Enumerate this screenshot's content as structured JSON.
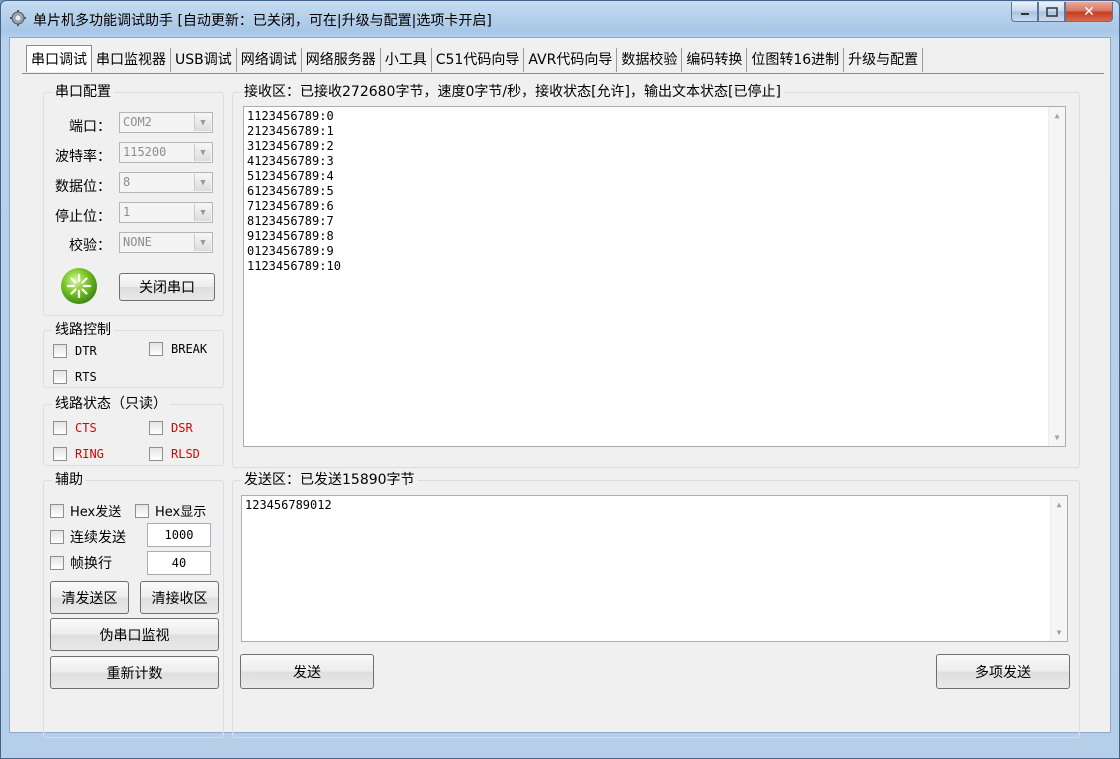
{
  "window": {
    "title": "单片机多功能调试助手 [自动更新：已关闭，可在|升级与配置|选项卡开启]",
    "icon": "gear-icon"
  },
  "tabs": [
    "串口调试",
    "串口监视器",
    "USB调试",
    "网络调试",
    "网络服务器",
    "小工具",
    "C51代码向导",
    "AVR代码向导",
    "数据校验",
    "编码转换",
    "位图转16进制",
    "升级与配置"
  ],
  "serial_config": {
    "legend": "串口配置",
    "port_label": "端口：",
    "port_value": "COM2",
    "baud_label": "波特率：",
    "baud_value": "115200",
    "databits_label": "数据位：",
    "databits_value": "8",
    "stopbits_label": "停止位：",
    "stopbits_value": "1",
    "parity_label": "校验：",
    "parity_value": "NONE",
    "status_icon": "port-open-indicator-icon",
    "close_button": "关闭串口"
  },
  "line_control": {
    "legend": "线路控制",
    "dtr": "DTR",
    "break": "BREAK",
    "rts": "RTS"
  },
  "line_status": {
    "legend": "线路状态（只读）",
    "cts": "CTS",
    "dsr": "DSR",
    "ring": "RING",
    "rlsd": "RLSD",
    "color": "#e00000"
  },
  "assist": {
    "legend": "辅助",
    "hex_send": "Hex发送",
    "hex_show": "Hex显示",
    "continuous_send": "连续发送",
    "continuous_value": "1000",
    "frame_newline": "帧换行",
    "frame_value": "40",
    "clear_send": "清发送区",
    "clear_receive": "清接收区",
    "fake_monitor": "伪串口监视",
    "recount": "重新计数"
  },
  "receive": {
    "legend": "接收区：已接收272680字节，速度0字节/秒，接收状态[允许]，输出文本状态[已停止]",
    "lines": [
      "1123456789:0",
      "2123456789:1",
      "3123456789:2",
      "4123456789:3",
      "5123456789:4",
      "6123456789:5",
      "7123456789:6",
      "8123456789:7",
      "9123456789:8",
      "0123456789:9",
      "1123456789:10"
    ]
  },
  "send": {
    "legend": "发送区：已发送15890字节",
    "text": "123456789012",
    "send_button": "发送",
    "multi_send_button": "多项发送"
  }
}
